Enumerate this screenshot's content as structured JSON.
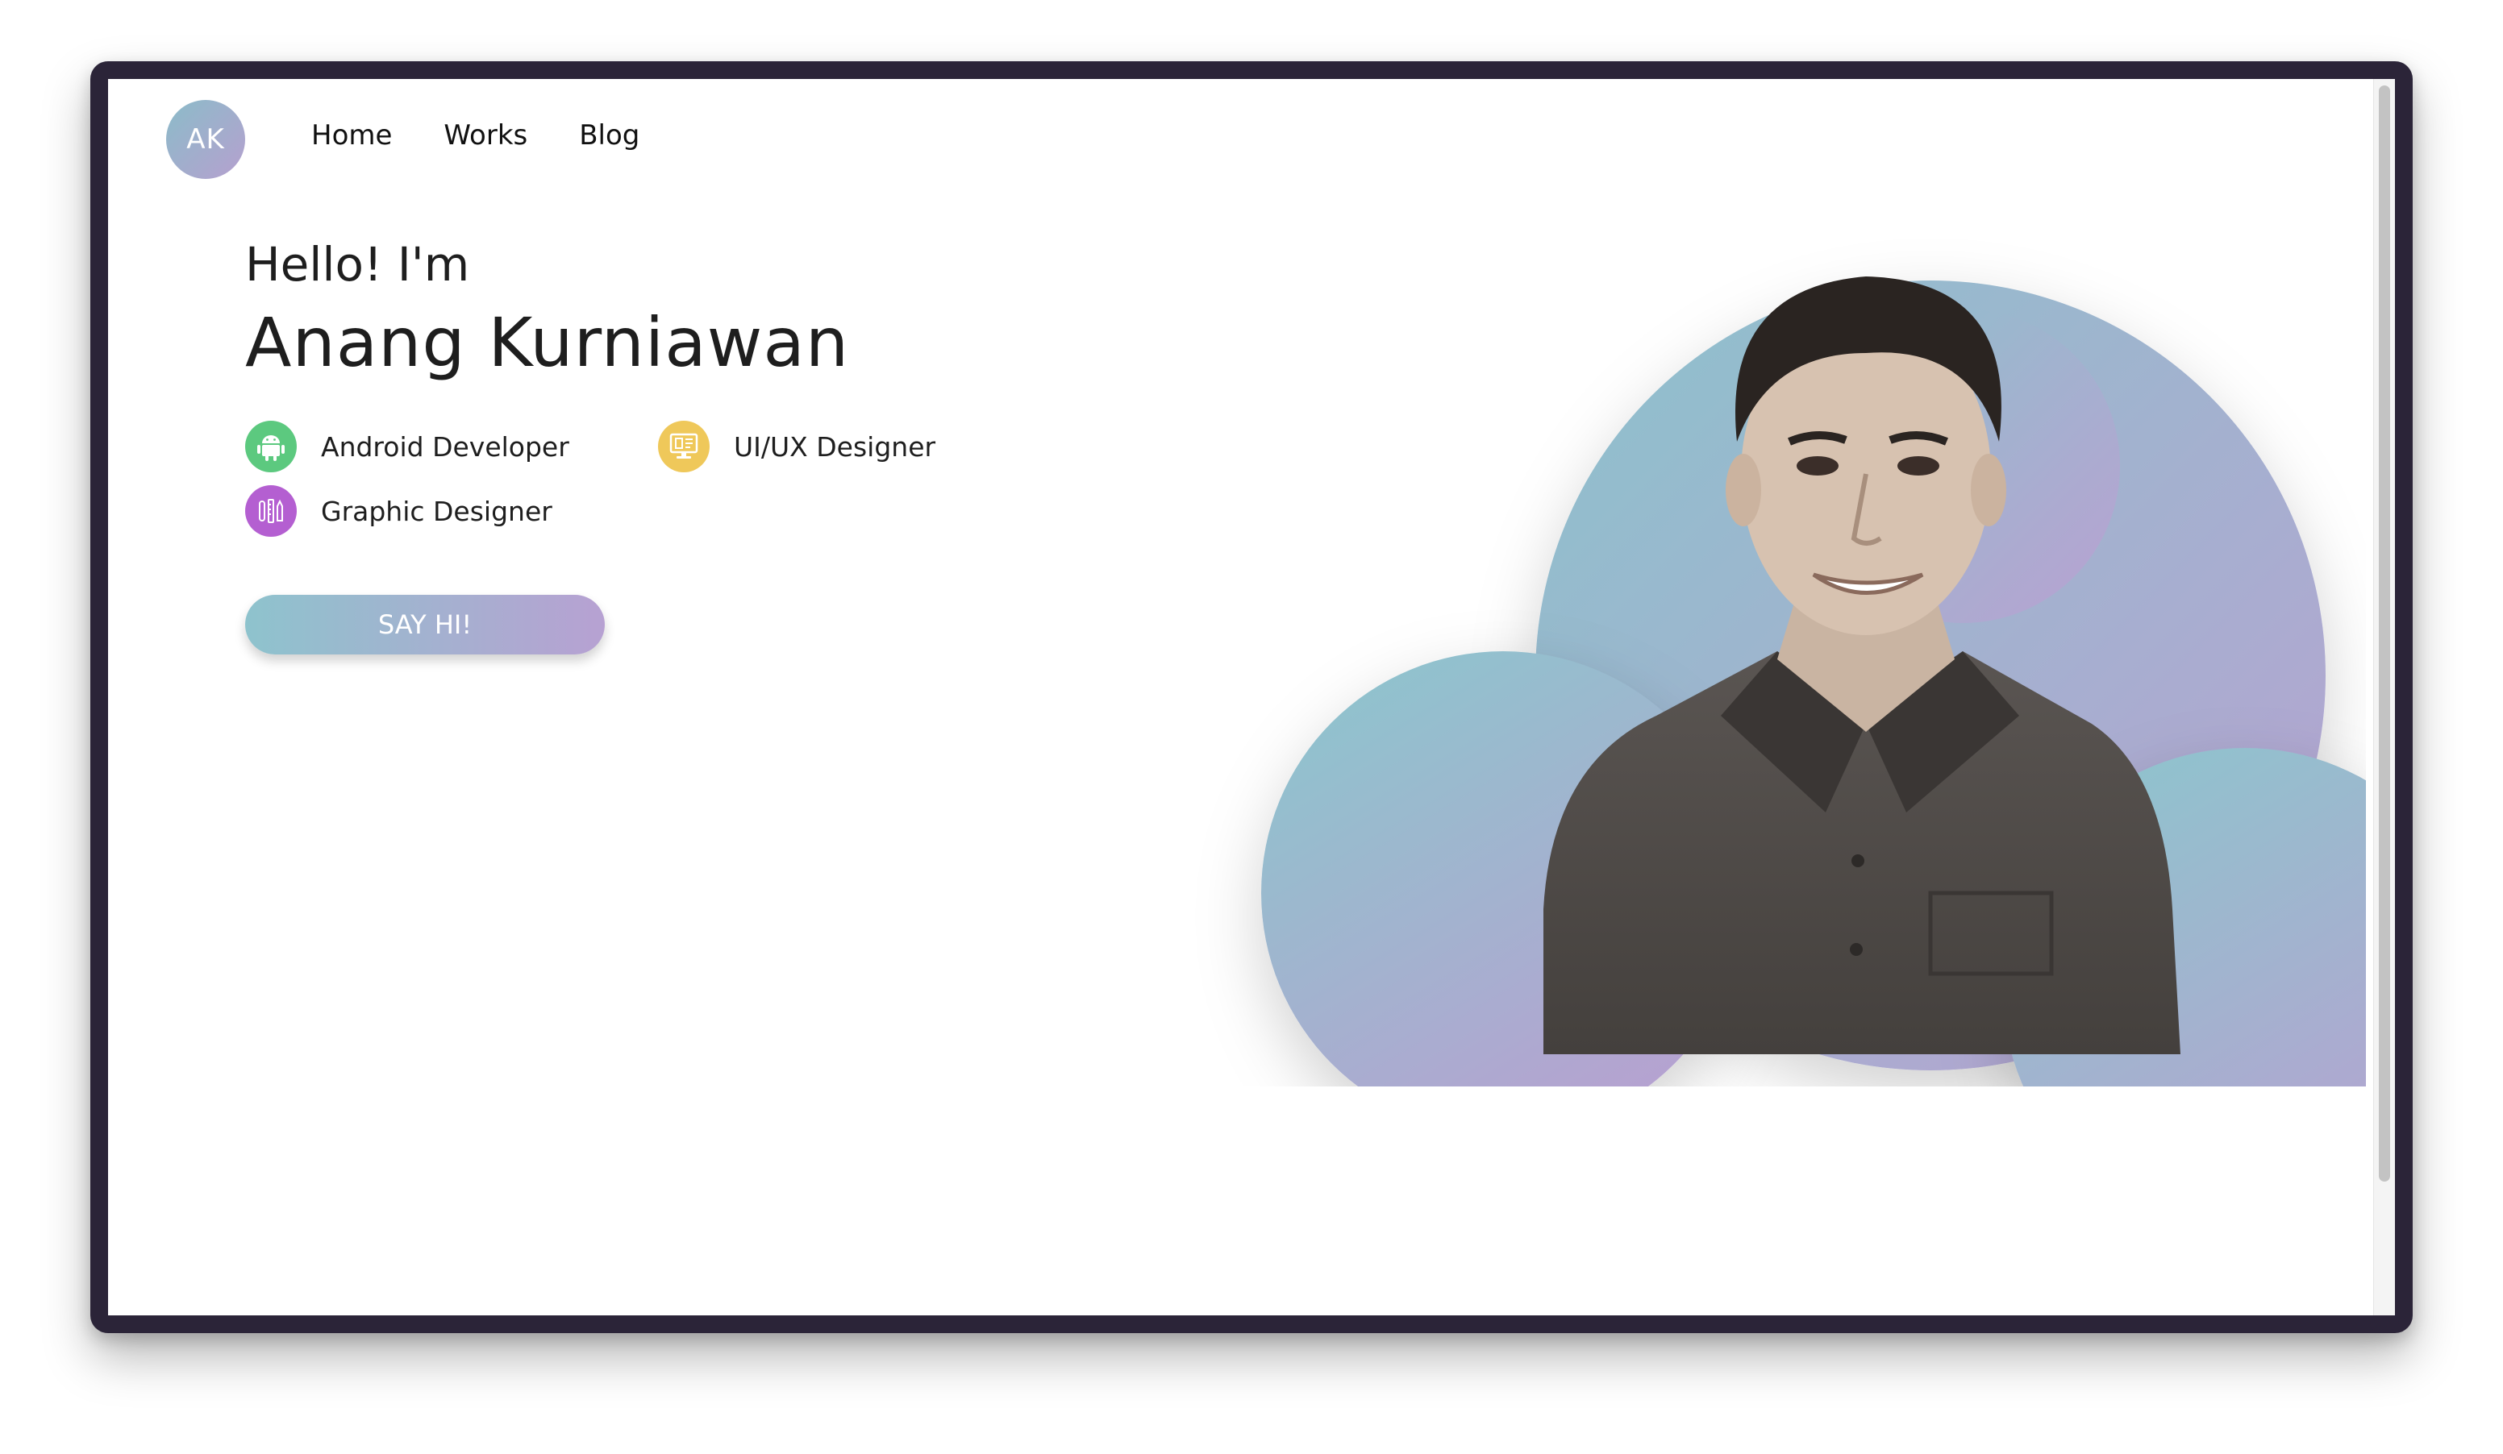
{
  "nav": {
    "logo_initials": "AK",
    "links": [
      "Home",
      "Works",
      "Blog"
    ]
  },
  "hero": {
    "greeting": "Hello! I'm",
    "name": "Anang Kurniawan",
    "roles": [
      {
        "label": "Android Developer",
        "icon": "android-icon",
        "color": "#5cc97f"
      },
      {
        "label": "UI/UX Designer",
        "icon": "monitor-icon",
        "color": "#efc85a"
      },
      {
        "label": "Graphic Designer",
        "icon": "design-tools-icon",
        "color": "#b45fd1"
      }
    ],
    "cta_label": "SAY HI!"
  },
  "colors": {
    "gradient_start": "#8ec3cd",
    "gradient_end": "#b7a1d2"
  }
}
